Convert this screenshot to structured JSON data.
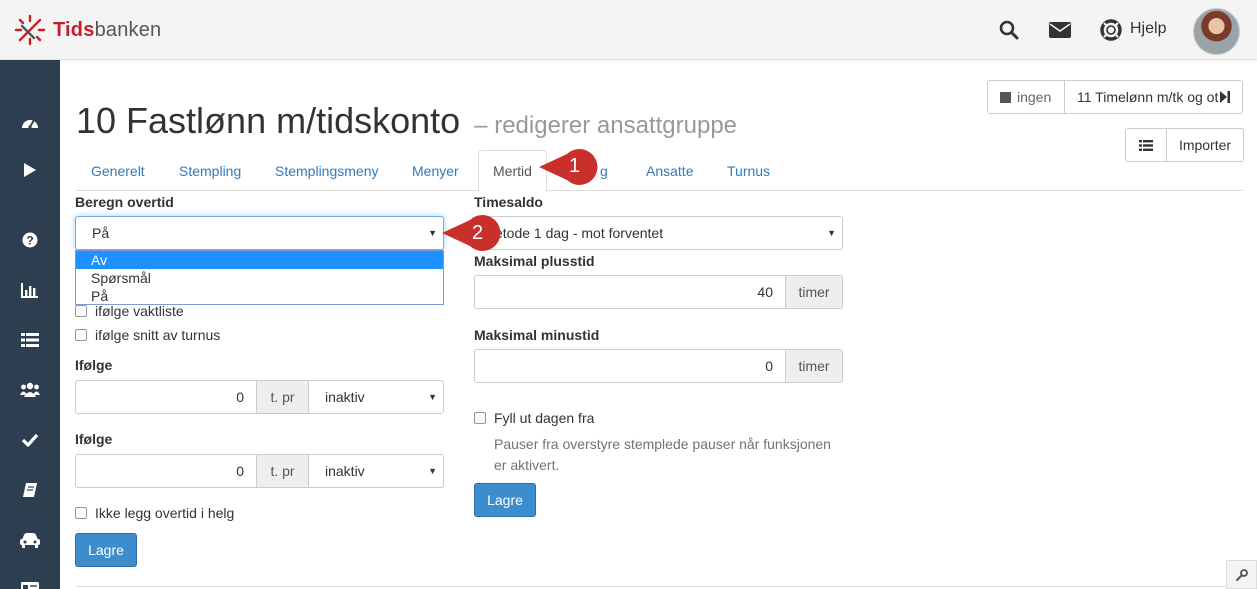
{
  "brand": {
    "name_bold": "Tids",
    "name_rest": "banken"
  },
  "header": {
    "help_label": "Hjelp",
    "icons": [
      "search-icon",
      "envelope-icon",
      "lifebuoy-icon"
    ]
  },
  "sidebar": {
    "icons": [
      "dashboard-icon",
      "play-icon",
      "question-icon",
      "bar-chart-icon",
      "list-icon",
      "users-icon",
      "check-icon",
      "book-icon",
      "car-icon",
      "id-card-icon"
    ]
  },
  "page": {
    "title": "10 Fastlønn m/tidskonto",
    "subtitle": "– redigerer ansattgruppe"
  },
  "nav_buttons": {
    "prev_label": "ingen",
    "next_label": "11 Timelønn m/tk og ot",
    "import_label": "Importer"
  },
  "tabs": [
    {
      "label": "Generelt"
    },
    {
      "label": "Stempling"
    },
    {
      "label": "Stemplingsmeny"
    },
    {
      "label": "Menyer"
    },
    {
      "label": "Mertid",
      "active": true
    },
    {
      "label": "g"
    },
    {
      "label": "Ansatte"
    },
    {
      "label": "Turnus"
    }
  ],
  "left": {
    "overtid_label": "Beregn overtid",
    "overtid_value": "På",
    "overtid_options": [
      "Av",
      "Spørsmål",
      "På"
    ],
    "overtid_highlighted": "Av",
    "chk_vaktliste": "ifølge vaktliste",
    "chk_snitt": "ifølge snitt av turnus",
    "ifolge1": {
      "label": "Ifølge",
      "value": "0",
      "unit": "t. pr",
      "select": "inaktiv"
    },
    "ifolge2": {
      "label": "Ifølge",
      "value": "0",
      "unit": "t. pr",
      "select": "inaktiv"
    },
    "chk_helg": "Ikke legg overtid i helg",
    "save_label": "Lagre"
  },
  "right": {
    "timesaldo_label": "Timesaldo",
    "timesaldo_value": "etode 1 dag - mot forventet",
    "plusstid_label": "Maksimal plusstid",
    "plusstid_value": "40",
    "plusstid_unit": "timer",
    "minustid_label": "Maksimal minustid",
    "minustid_value": "0",
    "minustid_unit": "timer",
    "chk_fyll": "Fyll ut dagen fra",
    "help_text": "Pauser fra overstyre stemplede pauser når funksjonen er aktivert.",
    "save_label": "Lagre"
  },
  "callouts": [
    "1",
    "2"
  ],
  "colors": {
    "brand_red": "#c51f2b",
    "sidebar_bg": "#2c3e50",
    "link_blue": "#337ab7",
    "primary_btn": "#3c8dce",
    "callout_red": "#c9302c"
  }
}
